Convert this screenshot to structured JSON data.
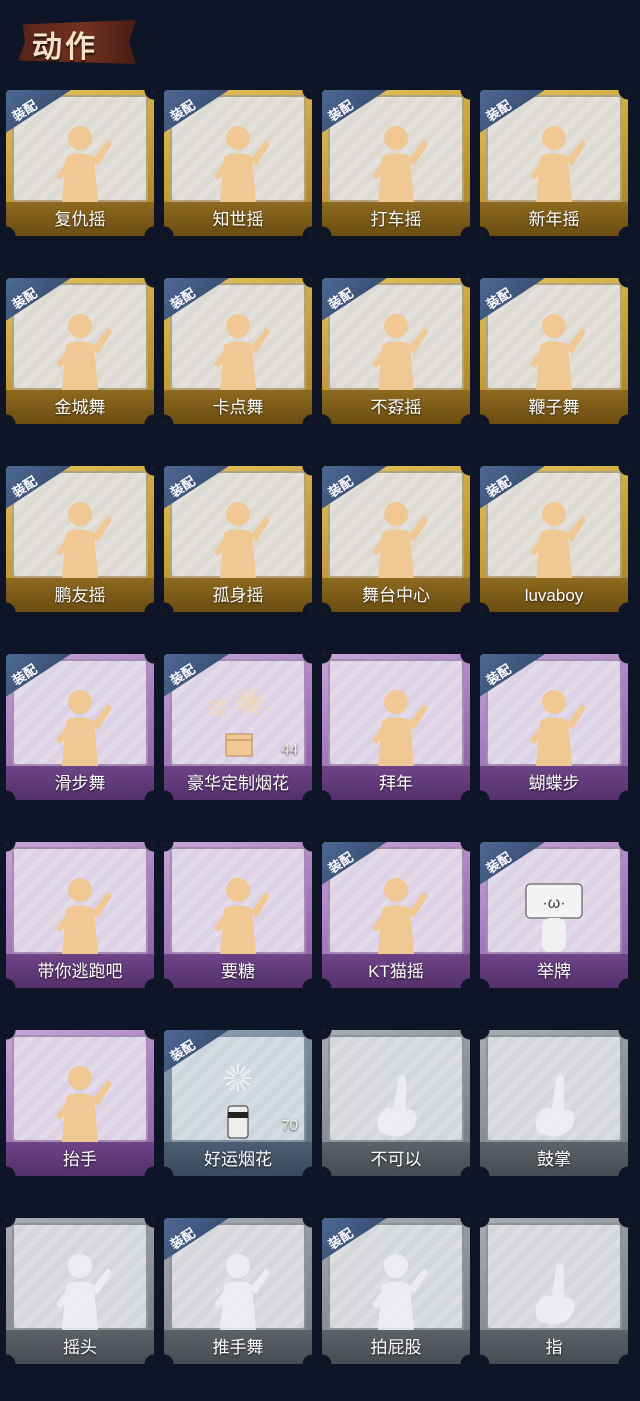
{
  "header": {
    "title": "动作"
  },
  "badge_text": "装配",
  "colors": {
    "gold": "#c9a23a",
    "purple": "#a57bbd",
    "blue": "#6f8399",
    "gray": "#8b9097",
    "background": "#0d1526"
  },
  "actions": [
    {
      "label": "复仇摇",
      "tier": "gold",
      "equipped": true,
      "icon": "dance-figure-icon"
    },
    {
      "label": "知世摇",
      "tier": "gold",
      "equipped": true,
      "icon": "dance-figure-icon"
    },
    {
      "label": "打车摇",
      "tier": "gold",
      "equipped": true,
      "icon": "dance-figure-icon"
    },
    {
      "label": "新年摇",
      "tier": "gold",
      "equipped": true,
      "icon": "dance-figure-icon"
    },
    {
      "label": "金城舞",
      "tier": "gold",
      "equipped": true,
      "icon": "dance-figure-icon"
    },
    {
      "label": "卡点舞",
      "tier": "gold",
      "equipped": true,
      "icon": "dance-figure-icon"
    },
    {
      "label": "不孬摇",
      "tier": "gold",
      "equipped": true,
      "icon": "dance-figure-icon"
    },
    {
      "label": "鞭子舞",
      "tier": "gold",
      "equipped": true,
      "icon": "dance-figure-icon"
    },
    {
      "label": "鹏友摇",
      "tier": "gold",
      "equipped": true,
      "icon": "dance-figure-icon"
    },
    {
      "label": "孤身摇",
      "tier": "gold",
      "equipped": true,
      "icon": "dance-figure-icon"
    },
    {
      "label": "舞台中心",
      "tier": "gold",
      "equipped": true,
      "icon": "dance-figure-icon"
    },
    {
      "label": "luvaboy",
      "tier": "gold",
      "equipped": true,
      "icon": "dance-figure-icon"
    },
    {
      "label": "滑步舞",
      "tier": "purple",
      "equipped": true,
      "icon": "dance-figure-icon"
    },
    {
      "label": "豪华定制烟花",
      "tier": "purple",
      "equipped": true,
      "icon": "fireworks-box-icon",
      "count": "44"
    },
    {
      "label": "拜年",
      "tier": "purple",
      "equipped": false,
      "icon": "bow-figure-icon"
    },
    {
      "label": "蝴蝶步",
      "tier": "purple",
      "equipped": true,
      "icon": "dance-figure-icon"
    },
    {
      "label": "带你逃跑吧",
      "tier": "purple",
      "equipped": false,
      "icon": "dance-figure-icon"
    },
    {
      "label": "要糖",
      "tier": "purple",
      "equipped": false,
      "icon": "figure-icon"
    },
    {
      "label": "KT猫摇",
      "tier": "purple",
      "equipped": true,
      "icon": "dance-figure-icon"
    },
    {
      "label": "举牌",
      "tier": "purple",
      "equipped": true,
      "icon": "sign-figure-icon"
    },
    {
      "label": "抬手",
      "tier": "purple",
      "equipped": false,
      "icon": "figure-icon"
    },
    {
      "label": "好运烟花",
      "tier": "blue",
      "equipped": true,
      "icon": "firework-cylinder-icon",
      "count": "70"
    },
    {
      "label": "不可以",
      "tier": "gray",
      "equipped": false,
      "icon": "finger-wag-icon"
    },
    {
      "label": "鼓掌",
      "tier": "gray",
      "equipped": false,
      "icon": "clap-icon"
    },
    {
      "label": "摇头",
      "tier": "gray",
      "equipped": false,
      "icon": "figure-icon"
    },
    {
      "label": "推手舞",
      "tier": "gray",
      "equipped": true,
      "icon": "figure-icon"
    },
    {
      "label": "拍屁股",
      "tier": "gray",
      "equipped": true,
      "icon": "figure-icon"
    },
    {
      "label": "指",
      "tier": "gray",
      "equipped": false,
      "icon": "pointing-hand-icon"
    }
  ]
}
